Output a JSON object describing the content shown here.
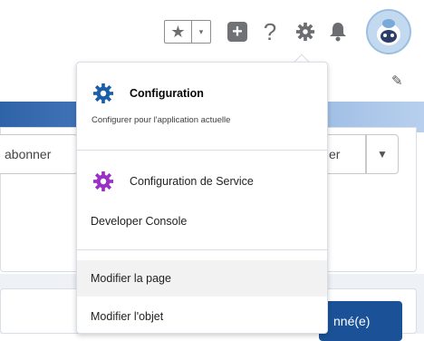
{
  "header": {
    "favorites_star": "★",
    "favorites_caret": "▾",
    "add_icon": "+",
    "help_icon": "?"
  },
  "background": {
    "subscribe_label": "abonner",
    "right_button_fragment": "er",
    "primary_fragment": "nné(e)"
  },
  "menu": {
    "config_title": "Configuration",
    "config_subtitle": "Configurer pour l'application actuelle",
    "service_title": "Configuration de Service",
    "developer_console": "Developer Console",
    "edit_page": "Modifier la page",
    "edit_object": "Modifier l'objet"
  },
  "colors": {
    "config_gear": "#1b5fa8",
    "service_gear": "#9b30c8",
    "primary_button": "#1b5297"
  }
}
